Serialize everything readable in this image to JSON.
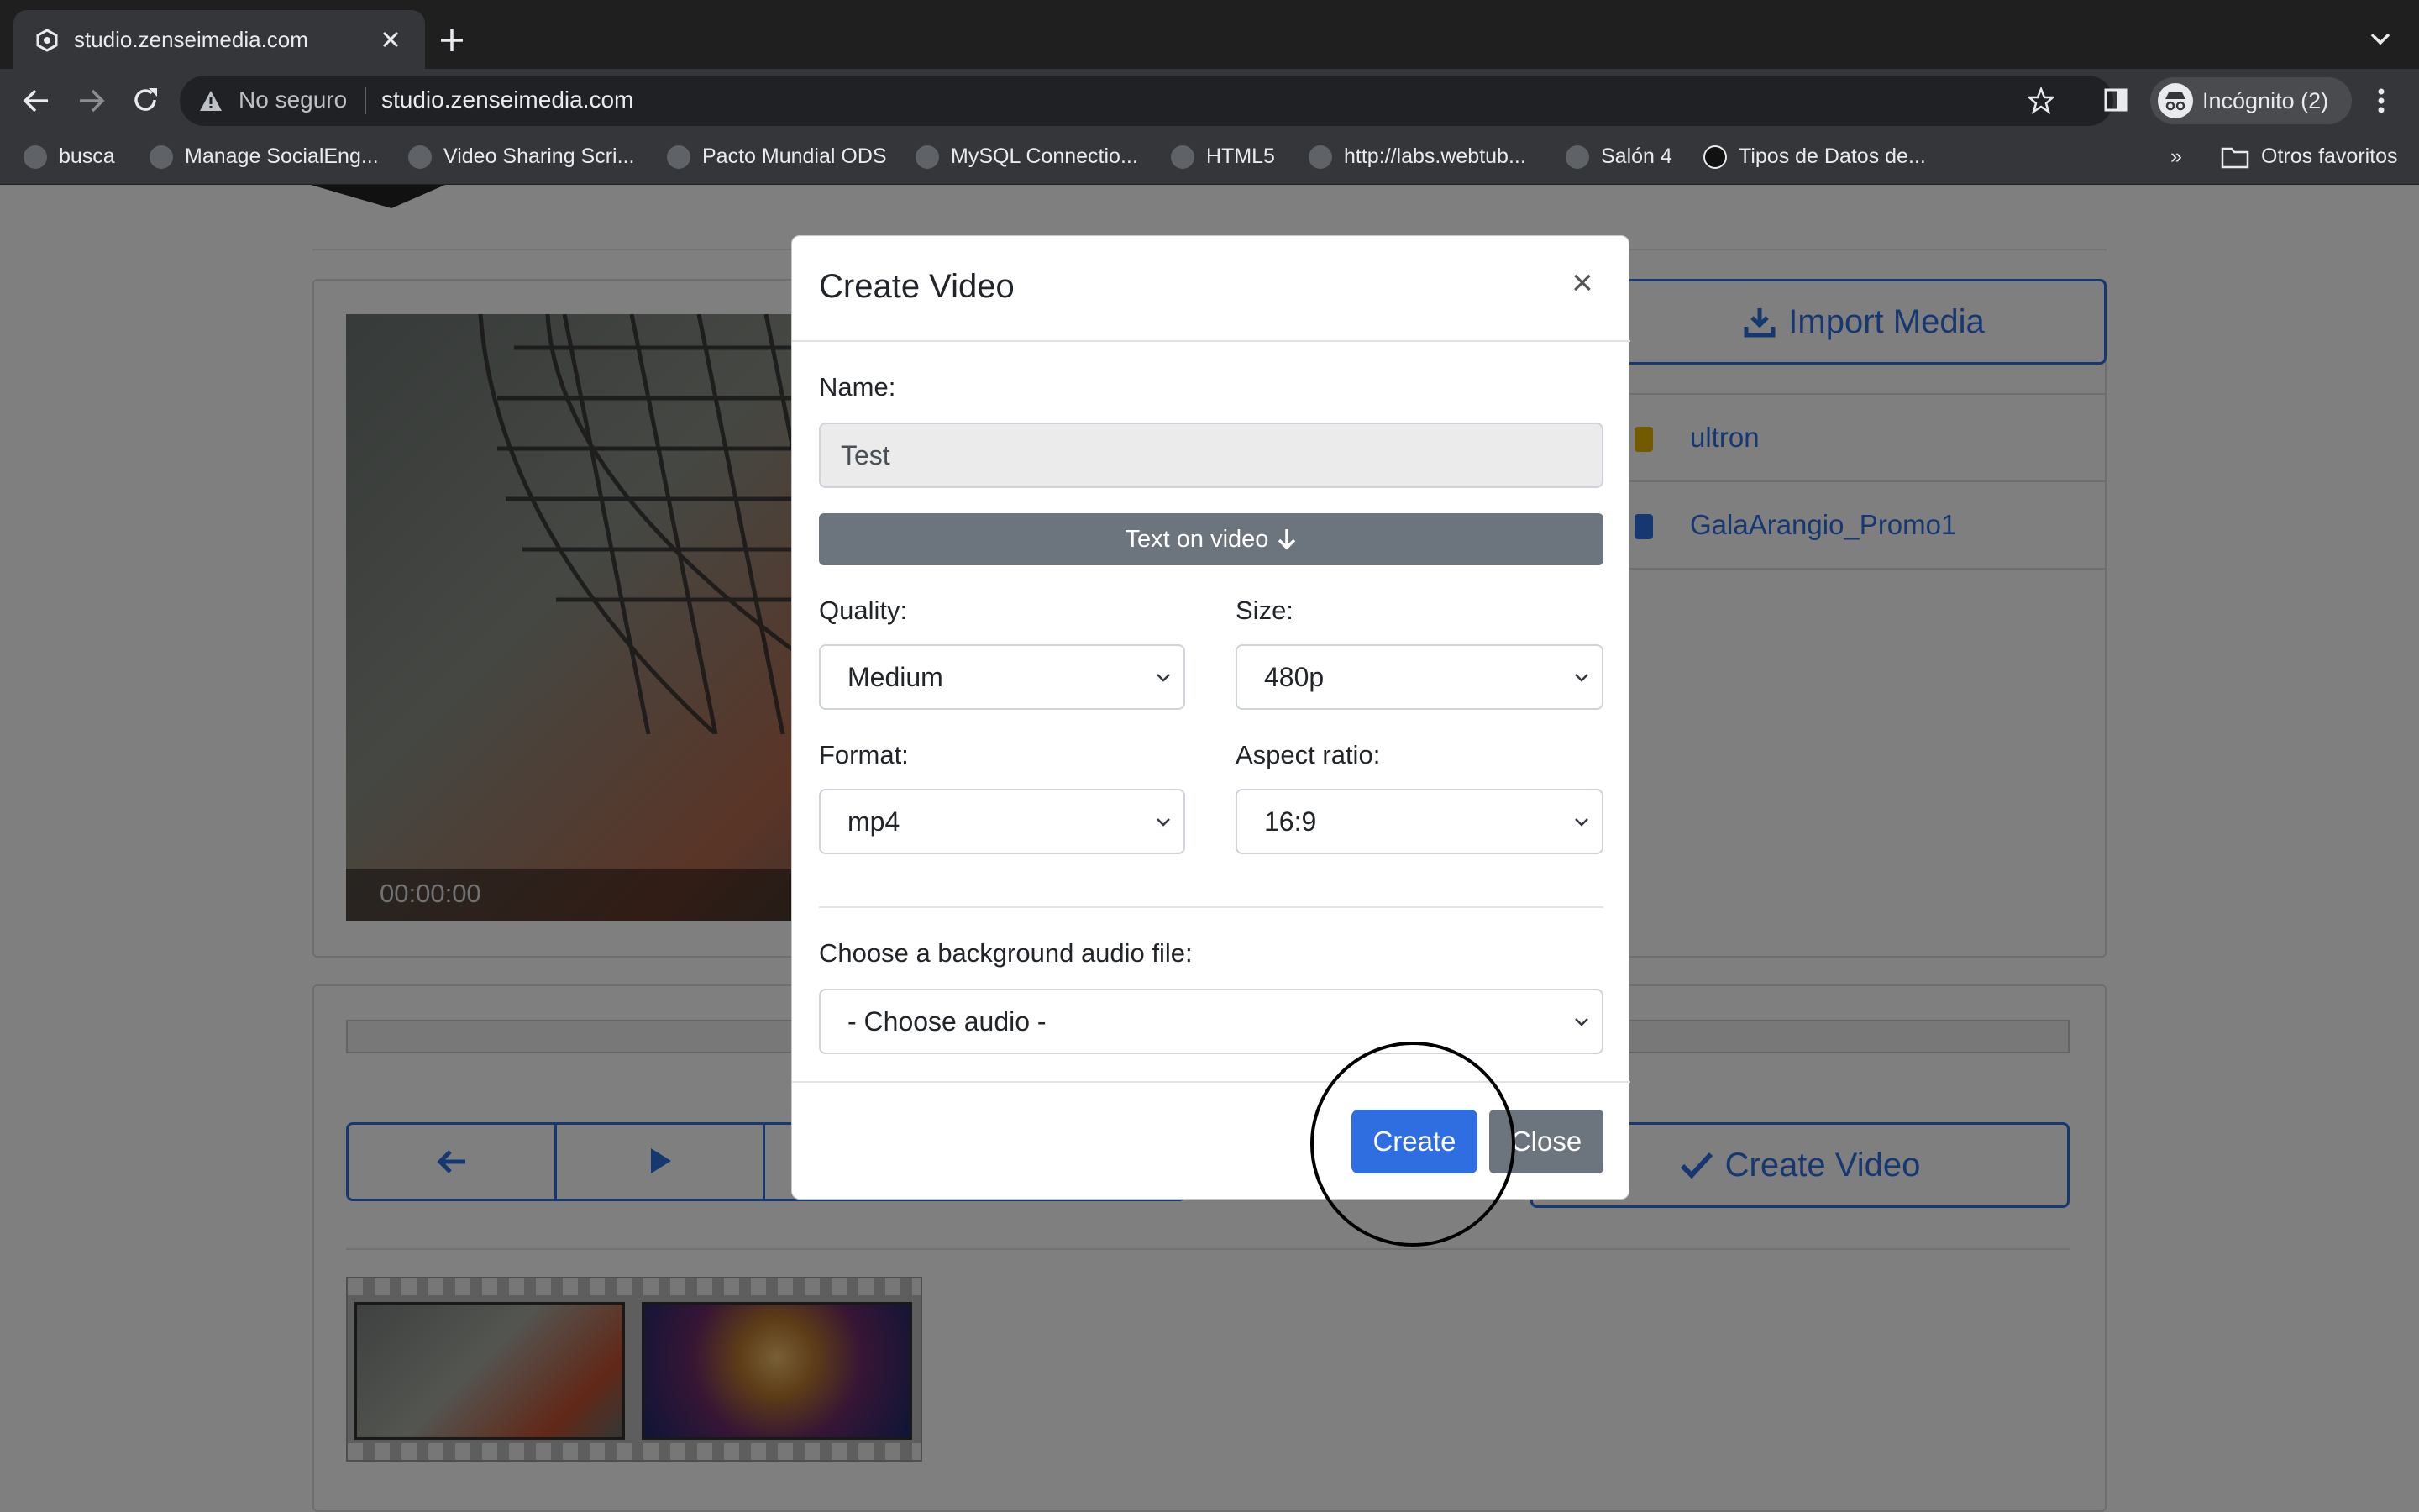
{
  "browser": {
    "tab_title": "studio.zenseimedia.com",
    "security_label": "No seguro",
    "url": "studio.zenseimedia.com",
    "profile_label": "Incógnito (2)",
    "bookmarks": [
      "busca",
      "Manage SocialEng...",
      "Video Sharing Scri...",
      "Pacto Mundial ODS",
      "MySQL Connectio...",
      "HTML5",
      "http://labs.webtub...",
      "Salón 4",
      "Tipos de Datos de..."
    ],
    "bookmarks_overflow": "»",
    "other_bookmarks": "Otros favoritos"
  },
  "page": {
    "import_media_label": "Import Media",
    "media_items": [
      "ultron",
      "GalaArangio_Promo1"
    ],
    "video_timecode": "00:00:00",
    "create_video_label": "Create Video"
  },
  "modal": {
    "title": "Create Video",
    "close_symbol": "×",
    "name_label": "Name:",
    "name_value": "Test",
    "text_on_video_label": "Text on video",
    "quality_label": "Quality:",
    "quality_value": "Medium",
    "size_label": "Size:",
    "size_value": "480p",
    "format_label": "Format:",
    "format_value": "mp4",
    "aspect_label": "Aspect ratio:",
    "aspect_value": "16:9",
    "audio_label": "Choose a background audio file:",
    "audio_value": "- Choose audio -",
    "create_button": "Create",
    "close_button": "Close"
  },
  "colors": {
    "primary": "#2f6ee0",
    "secondary": "#6c757d",
    "chrome_dark": "#35363a"
  }
}
